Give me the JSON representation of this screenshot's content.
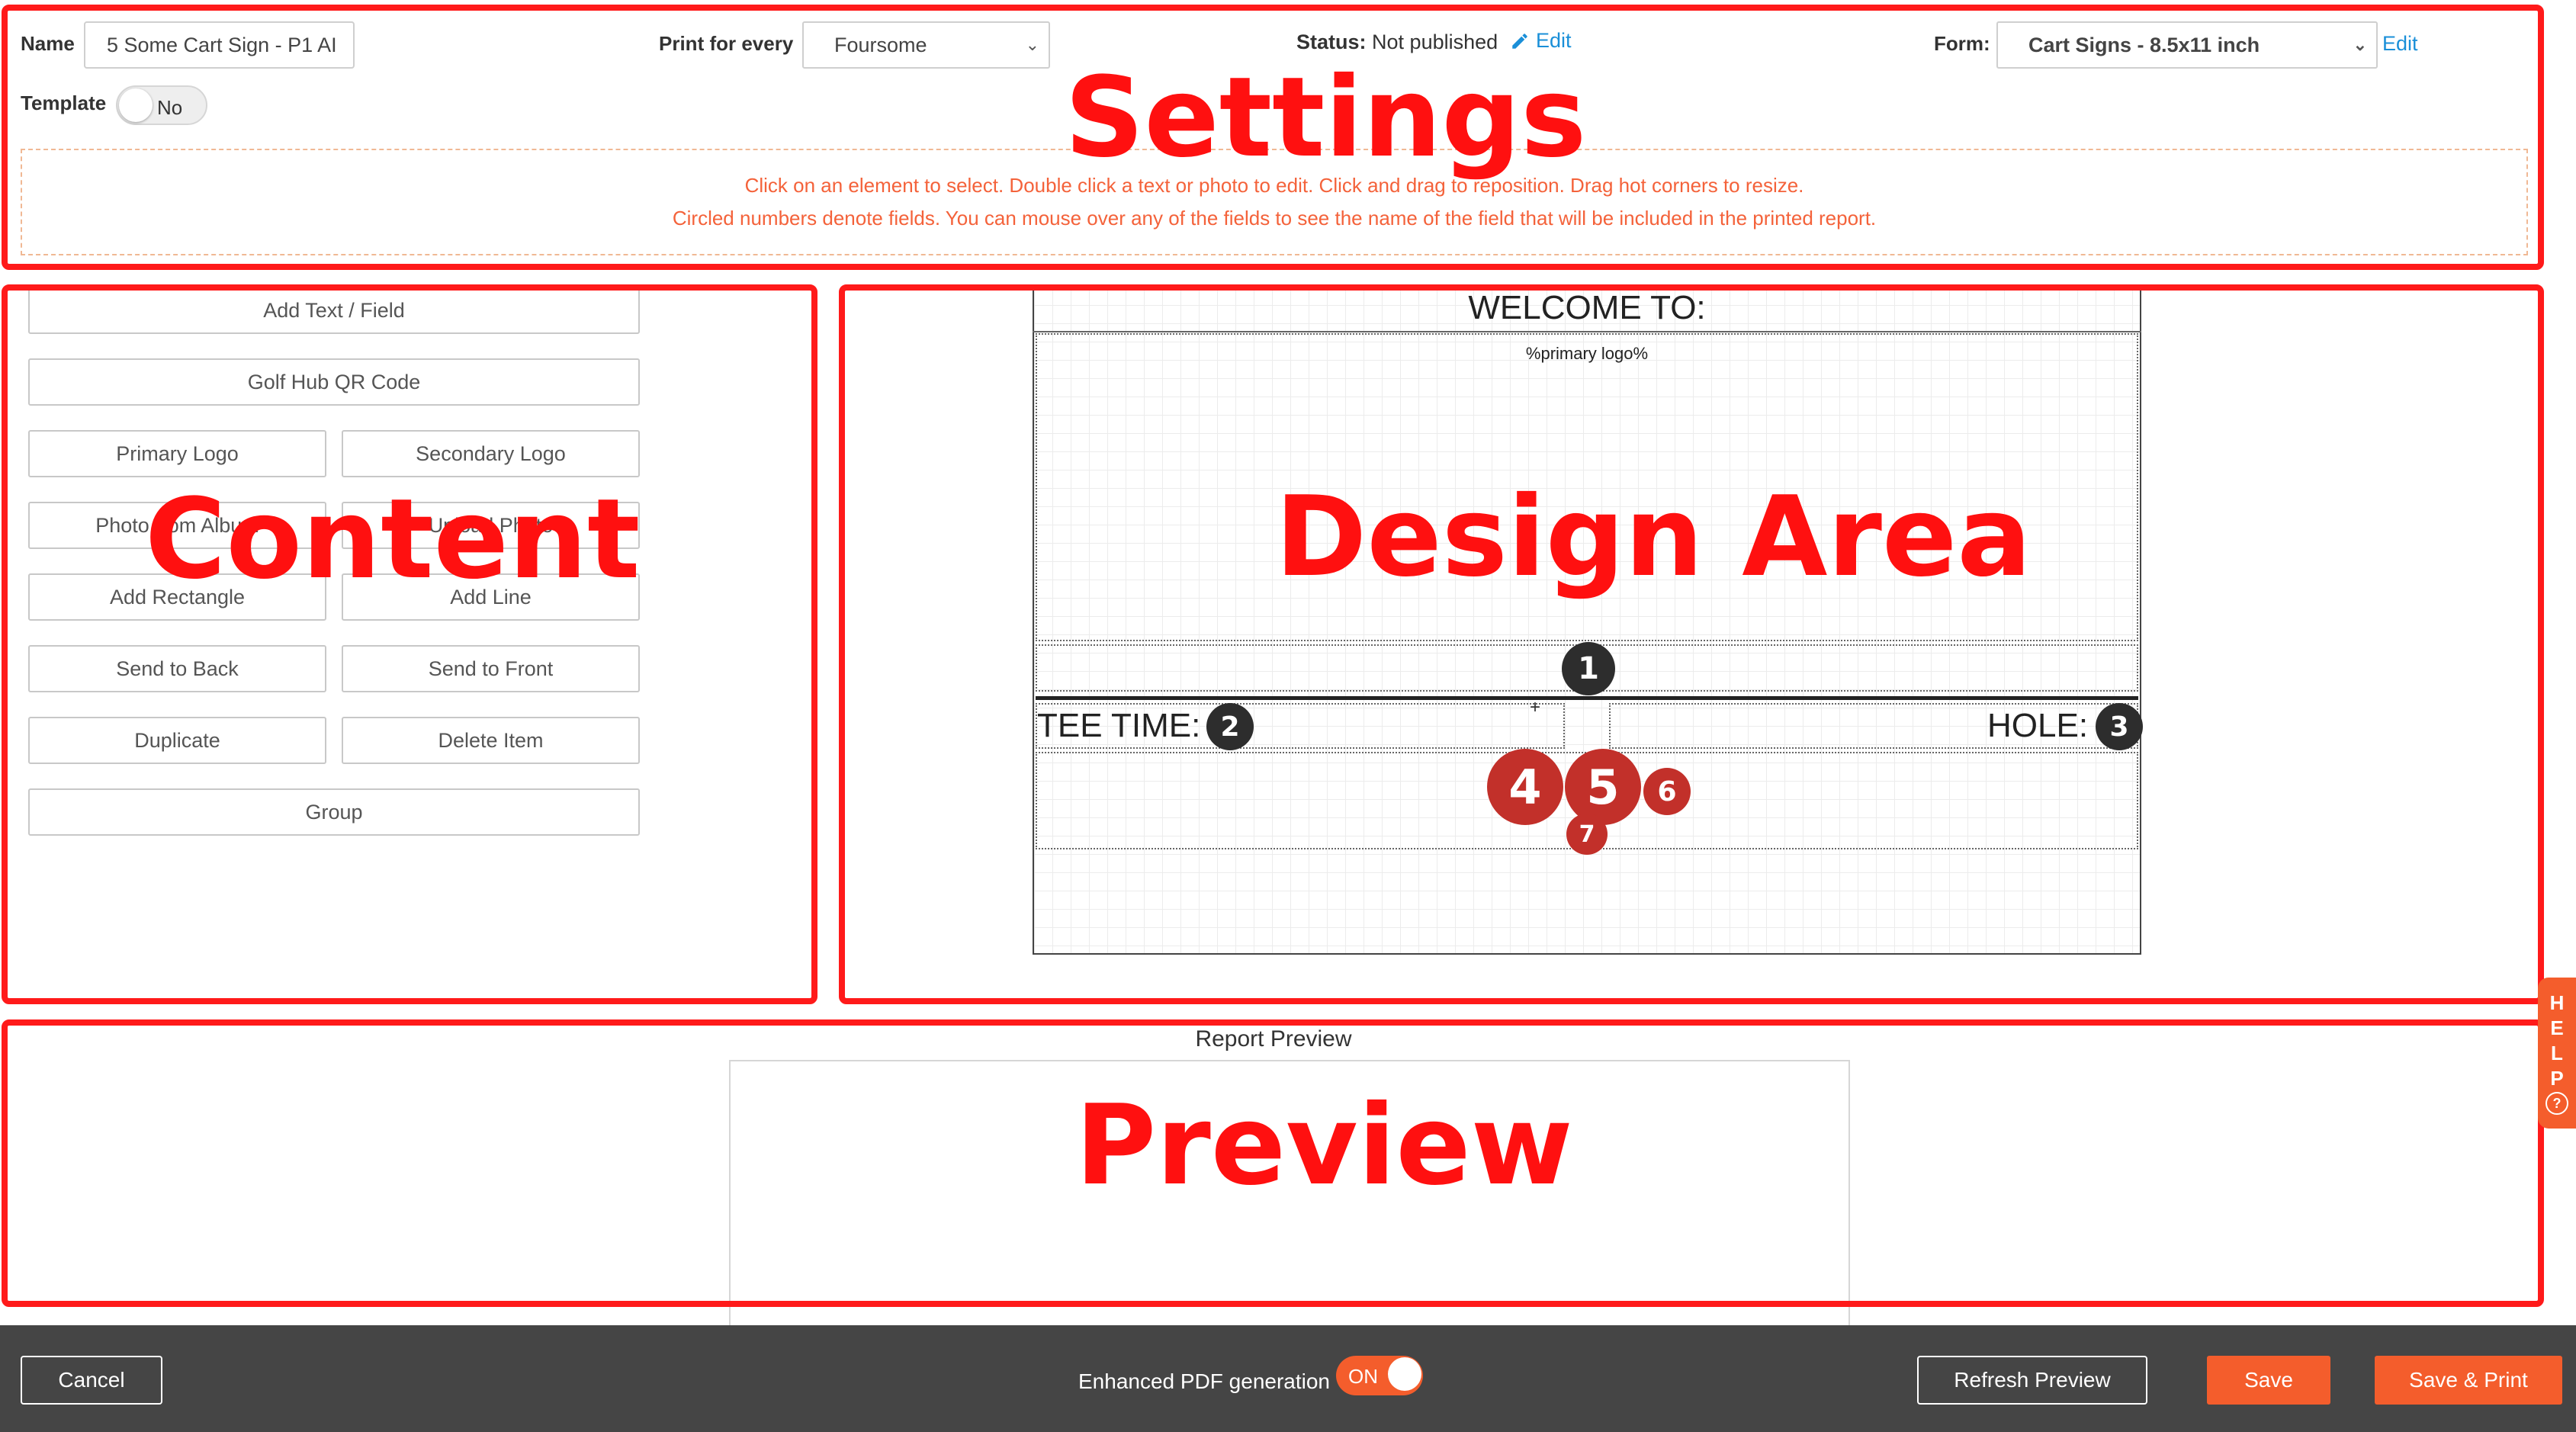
{
  "settings": {
    "name_label": "Name",
    "name_value": "5 Some Cart Sign - P1 AI",
    "print_for_every_label": "Print for every",
    "print_for_every_value": "Foursome",
    "status_label": "Status:",
    "status_value": "Not published",
    "status_edit": "Edit",
    "form_label": "Form:",
    "form_value": "Cart Signs - 8.5x11 inch",
    "form_edit": "Edit",
    "template_label": "Template",
    "template_toggle": "No",
    "instructions_line1": "Click on an element to select. Double click a text or photo to edit. Click and drag to reposition. Drag hot corners to resize.",
    "instructions_line2": "Circled numbers denote fields. You can mouse over any of the fields to see the name of the field that will be included in the printed report."
  },
  "content_buttons": {
    "add_text": "Add Text / Field",
    "qr_code": "Golf Hub QR Code",
    "primary_logo": "Primary Logo",
    "secondary_logo": "Secondary Logo",
    "photo_album": "Photo from Album",
    "upload_photo": "Upload Photo",
    "add_rectangle": "Add Rectangle",
    "add_line": "Add Line",
    "send_back": "Send to Back",
    "send_front": "Send to Front",
    "duplicate": "Duplicate",
    "delete_item": "Delete Item",
    "group": "Group"
  },
  "design": {
    "welcome": "WELCOME TO:",
    "logo_placeholder": "%primary logo%",
    "tee_time": "TEE TIME:",
    "hole": "HOLE:",
    "field_numbers": [
      "1",
      "2",
      "3",
      "4",
      "5",
      "6",
      "7"
    ]
  },
  "preview": {
    "title": "Report Preview"
  },
  "annotations": {
    "settings": "Settings",
    "content": "Content",
    "design": "Design Area",
    "preview": "Preview"
  },
  "help_tab": {
    "letters": [
      "H",
      "E",
      "L",
      "P"
    ],
    "icon": "?"
  },
  "footer": {
    "cancel": "Cancel",
    "enhanced_pdf_label": "Enhanced PDF generation",
    "enhanced_pdf_toggle": "ON",
    "refresh": "Refresh Preview",
    "save": "Save",
    "save_print": "Save & Print"
  },
  "colors": {
    "annotation_red": "#ff1a1a",
    "accent_orange": "#f45d2c",
    "link_blue": "#1a8fd8",
    "footer_bg": "#454545",
    "badge_dark": "#2d2d2d",
    "badge_red": "#c2302a"
  },
  "icons": {
    "edit": "pencil-icon",
    "dropdown": "chevron-down-icon",
    "help": "question-circle-icon",
    "crosshair": "plus-icon"
  }
}
